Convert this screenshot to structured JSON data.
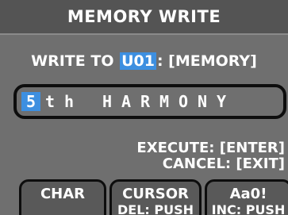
{
  "header": {
    "title": "MEMORY WRITE"
  },
  "write": {
    "prefix": "WRITE TO",
    "dest_code": "U01",
    "suffix": ": [MEMORY]"
  },
  "name_editor": {
    "chars": [
      "5",
      "t",
      "h",
      " ",
      "H",
      "A",
      "R",
      "M",
      "O",
      "N",
      "Y"
    ],
    "cursor_index": 0
  },
  "instructions": {
    "execute": "EXECUTE: [ENTER]",
    "cancel": "CANCEL: [EXIT]"
  },
  "function_buttons": [
    {
      "label": "CHAR",
      "sub": ""
    },
    {
      "label": "CURSOR",
      "sub": "DEL: PUSH"
    },
    {
      "label": "Aa0!",
      "sub": "INC: PUSH"
    }
  ],
  "colors": {
    "accent": "#3d8fe0",
    "background": "#6f6f6f",
    "title_bar": "#545454"
  }
}
